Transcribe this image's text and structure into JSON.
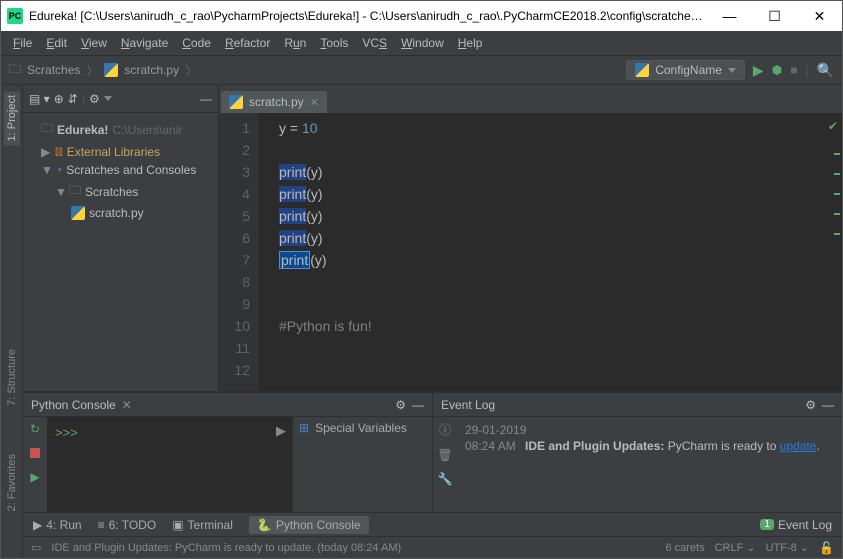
{
  "titlebar": {
    "icon_text": "PC",
    "title": "Edureka! [C:\\Users\\anirudh_c_rao\\PycharmProjects\\Edureka!] - C:\\Users\\anirudh_c_rao\\.PyCharmCE2018.2\\config\\scratches\\s..."
  },
  "menu": {
    "file": "File",
    "edit": "Edit",
    "view": "View",
    "navigate": "Navigate",
    "code": "Code",
    "refactor": "Refactor",
    "run": "Run",
    "tools": "Tools",
    "vcs": "VCS",
    "window": "Window",
    "help": "Help"
  },
  "navbar": {
    "crumb1": "Scratches",
    "crumb2": "scratch.py",
    "config_name": "ConfigName"
  },
  "left_tabs": {
    "project": "1: Project",
    "structure": "7: Structure",
    "favorites": "2: Favorites"
  },
  "tree": {
    "root": "Edureka!",
    "root_path": "C:\\Users\\anir",
    "ext_lib": "External Libraries",
    "scratches_consoles": "Scratches and Consoles",
    "scratches": "Scratches",
    "file": "scratch.py"
  },
  "editor": {
    "tab_name": "scratch.py",
    "lines": [
      "1",
      "2",
      "3",
      "4",
      "5",
      "6",
      "7",
      "8",
      "9",
      "10",
      "11",
      "12"
    ],
    "code": {
      "l1_var": "y",
      "l1_eq": " = ",
      "l1_val": "10",
      "print": "print",
      "arg": "(y)",
      "comment": "#Python is fun!"
    }
  },
  "console": {
    "title": "Python Console",
    "prompt": ">>>",
    "vars": "Special Variables"
  },
  "eventlog": {
    "title": "Event Log",
    "date": "29-01-2019",
    "time": "08:24 AM",
    "msg_bold": "IDE and Plugin Updates:",
    "msg_rest": " PyCharm is ready to ",
    "link": "update"
  },
  "bottom_tabs": {
    "run": "4: Run",
    "todo": "6: TODO",
    "terminal": "Terminal",
    "console": "Python Console",
    "event_log": "Event Log",
    "event_count": "1"
  },
  "status": {
    "msg": "IDE and Plugin Updates: PyCharm is ready to update. (today 08:24 AM)",
    "carets": "6 carets",
    "crlf": "CRLF",
    "enc": "UTF-8"
  }
}
